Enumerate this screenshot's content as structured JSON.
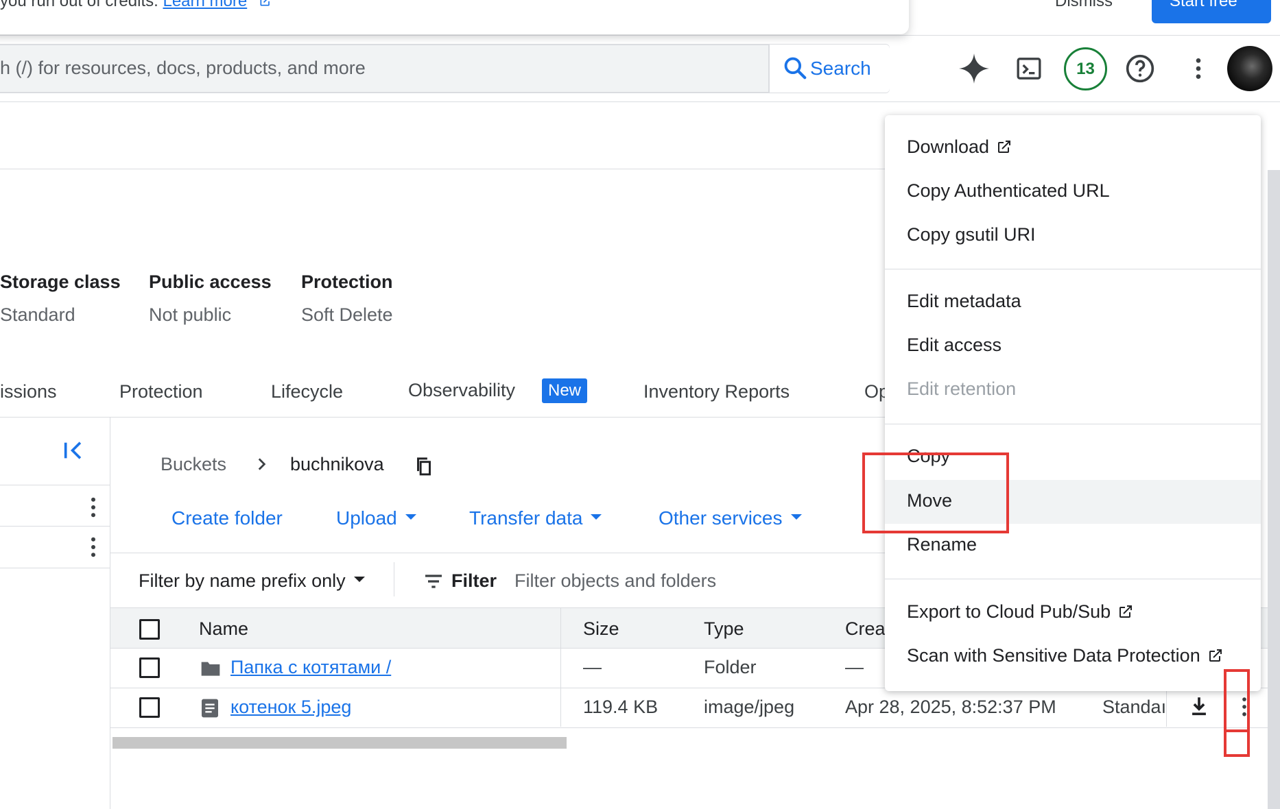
{
  "banner": {
    "text": "you run out of credits.",
    "link": "Learn more",
    "dismiss": "Dismiss",
    "start_free": "Start free"
  },
  "search": {
    "placeholder": "h (/) for resources, docs, products, and more",
    "button": "Search"
  },
  "header": {
    "notification_count": "13",
    "icons": [
      "gemini-sparkle-icon",
      "cloud-shell-icon",
      "help-icon",
      "more-vert-icon",
      "avatar"
    ]
  },
  "bucket_meta": {
    "storage_class_label": "Storage class",
    "storage_class_value": "Standard",
    "public_access_label": "Public access",
    "public_access_value": "Not public",
    "protection_label": "Protection",
    "protection_value": "Soft Delete"
  },
  "tabs": {
    "permissions": "issions",
    "protection": "Protection",
    "lifecycle": "Lifecycle",
    "observability": "Observability",
    "observability_badge": "New",
    "inventory": "Inventory Reports",
    "operations": "Op"
  },
  "breadcrumb": {
    "buckets": "Buckets",
    "bucket": "buchnikova"
  },
  "actions": {
    "create_folder": "Create folder",
    "upload": "Upload",
    "transfer": "Transfer data",
    "other": "Other services"
  },
  "filter": {
    "prefix": "Filter by name prefix only",
    "label": "Filter",
    "placeholder": "Filter objects and folders"
  },
  "table": {
    "headers": {
      "name": "Name",
      "size": "Size",
      "type": "Type",
      "created": "Crea"
    },
    "rows": [
      {
        "name": "Папка с котятами /",
        "size": "—",
        "type": "Folder",
        "created": "—",
        "storage": ""
      },
      {
        "name": "котенок 5.jpeg",
        "size": "119.4 KB",
        "type": "image/jpeg",
        "created": "Apr 28, 2025, 8:52:37 PM",
        "storage": "Standaı"
      }
    ]
  },
  "menu": {
    "download": "Download",
    "copy_url": "Copy Authenticated URL",
    "copy_gsutil": "Copy gsutil URI",
    "edit_metadata": "Edit metadata",
    "edit_access": "Edit access",
    "edit_retention": "Edit retention",
    "copy": "Copy",
    "move": "Move",
    "rename": "Rename",
    "export": "Export to Cloud Pub/Sub",
    "scan": "Scan with Sensitive Data Protection"
  },
  "colors": {
    "accent": "#1a73e8",
    "badge_green": "#188038",
    "annotation_red": "#e53935"
  }
}
